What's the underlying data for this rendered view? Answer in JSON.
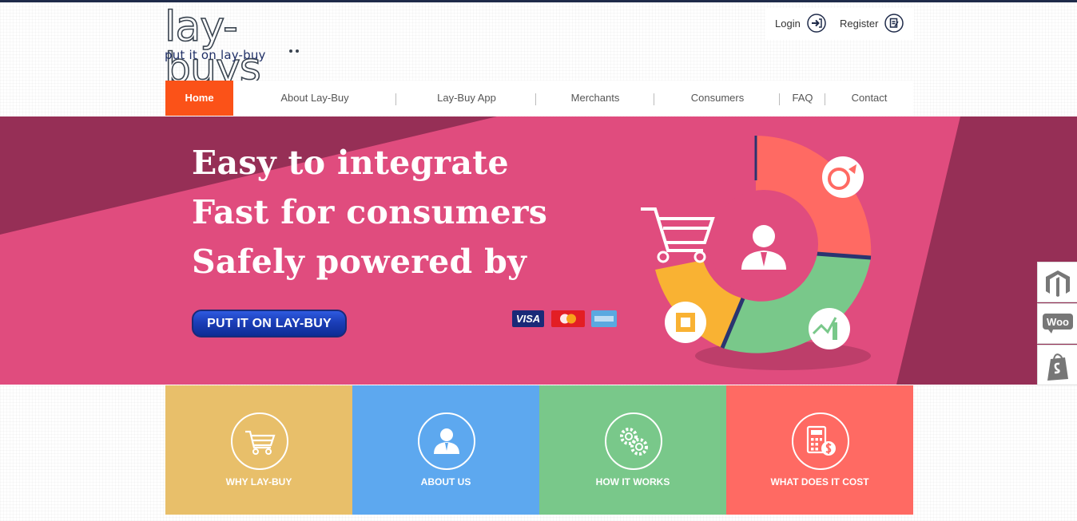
{
  "brand": {
    "logo_text": "lay-buys",
    "tagline": "put it on lay-buy"
  },
  "auth": {
    "login_label": "Login",
    "register_label": "Register"
  },
  "nav": {
    "items": [
      {
        "label": "Home",
        "active": true
      },
      {
        "label": "About Lay-Buy"
      },
      {
        "label": "Lay-Buy App"
      },
      {
        "label": "Merchants"
      },
      {
        "label": "Consumers"
      },
      {
        "label": "FAQ"
      },
      {
        "label": "Contact"
      }
    ]
  },
  "hero": {
    "lines": [
      "Easy to integrate",
      "Fast for consumers",
      "Safely powered by"
    ],
    "cta_label": "PUT IT ON LAY-BUY",
    "cards": {
      "visa": "VISA"
    }
  },
  "side_badges": [
    "magento-icon",
    "woo-icon",
    "shopify-icon"
  ],
  "side_badge_texts": {
    "woo": "Woo"
  },
  "tiles": [
    {
      "label": "WHY LAY-BUY",
      "color": "#e8bf6a"
    },
    {
      "label": "ABOUT US",
      "color": "#5da8ef"
    },
    {
      "label": "HOW IT WORKS",
      "color": "#79c88a"
    },
    {
      "label": "WHAT DOES IT COST",
      "color": "#ff6a63"
    }
  ],
  "colors": {
    "accent": "#fb5218",
    "hero_pink": "#e04c7e",
    "hero_dark": "#962f56",
    "cta_blue": "#1b3eb8"
  }
}
